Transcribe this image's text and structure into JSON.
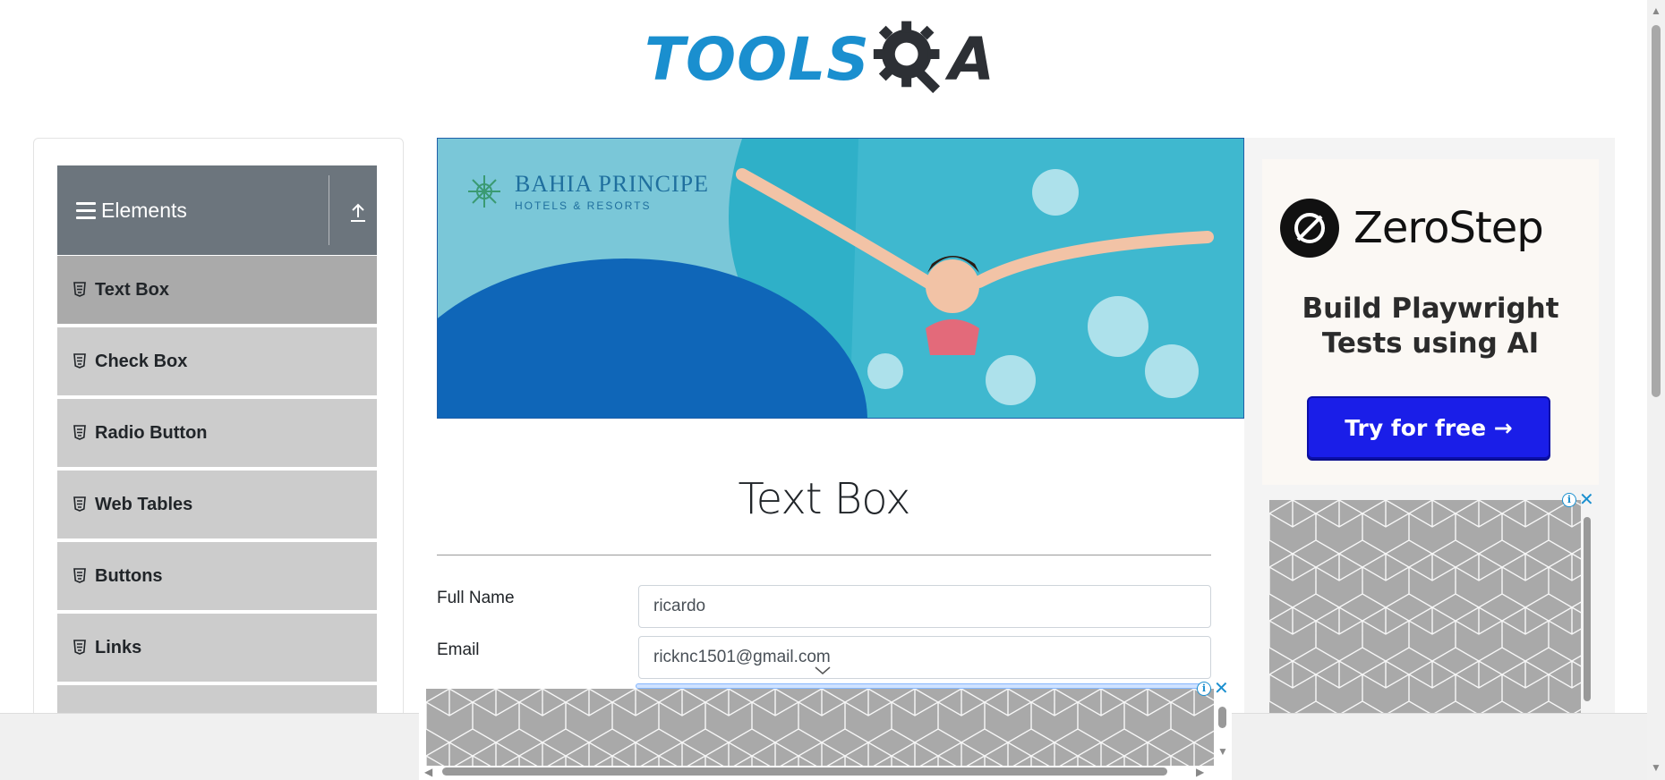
{
  "logo": {
    "tools": "TOOLS",
    "a": "A"
  },
  "sidebar": {
    "group_title": "Elements",
    "items": [
      {
        "label": "Text Box",
        "active": true
      },
      {
        "label": "Check Box"
      },
      {
        "label": "Radio Button"
      },
      {
        "label": "Web Tables"
      },
      {
        "label": "Buttons"
      },
      {
        "label": "Links"
      }
    ]
  },
  "banner_ad": {
    "brand": "BAHIA PRINCIPE",
    "sub": "HOTELS & RESORTS"
  },
  "main": {
    "title": "Text Box",
    "full_name_label": "Full Name",
    "full_name_value": "ricardo",
    "email_label": "Email",
    "email_value": "ricknc1501@gmail.com"
  },
  "right_ad": {
    "brand": "ZeroStep",
    "headline": "Build Playwright Tests using AI",
    "cta": "Try for free →"
  },
  "colors": {
    "brand_blue": "#1a8fcf",
    "sidebar_header": "#6c757d",
    "menu_item": "#cccccc",
    "menu_item_active": "#aaaaaa",
    "cta_blue": "#1a1ee8"
  }
}
